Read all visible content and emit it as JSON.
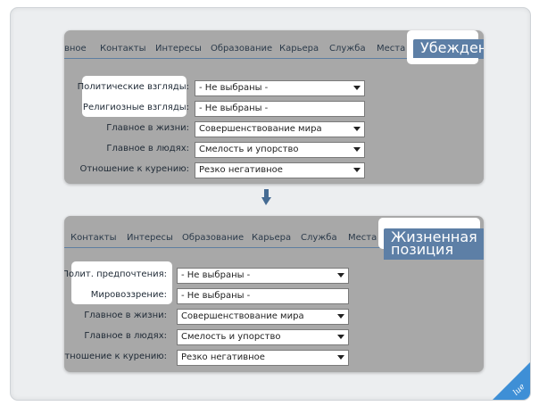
{
  "panel1": {
    "tabs": [
      "вное",
      "Контакты",
      "Интересы",
      "Образование",
      "Карьера",
      "Служба",
      "Места",
      "Убеждения"
    ],
    "active_tab": "Убеждения",
    "rows": [
      {
        "label": "Политические взгляды:",
        "value": "- Не выбраны -",
        "dropdown": true
      },
      {
        "label": "Религиозные взгляды:",
        "value": "- Не выбраны -",
        "dropdown": false
      },
      {
        "label": "Главное в жизни:",
        "value": "Совершенствование мира",
        "dropdown": true
      },
      {
        "label": "Главное в людях:",
        "value": "Смелость и упорство",
        "dropdown": true
      },
      {
        "label": "Отношение к курению:",
        "value": "Резко негативное",
        "dropdown": true
      }
    ]
  },
  "panel2": {
    "tabs": [
      "Контакты",
      "Интересы",
      "Образование",
      "Карьера",
      "Служба",
      "Места",
      "Жизненная позиция"
    ],
    "active_tab": "Жизненная позиция",
    "rows": [
      {
        "label": "Полит. предпочтения:",
        "value": "- Не выбраны -",
        "dropdown": true
      },
      {
        "label": "Мировоззрение:",
        "value": "- Не выбраны -",
        "dropdown": false
      },
      {
        "label": "Главное в жизни:",
        "value": "Совершенствование мира",
        "dropdown": true
      },
      {
        "label": "Главное в людях:",
        "value": "Смелость и упорство",
        "dropdown": true
      },
      {
        "label": "Отношение к курению:",
        "value": "Резко негативное",
        "dropdown": true
      }
    ]
  },
  "colors": {
    "panel_bg": "#a8a8a8",
    "active_tab": "#5d7fa6",
    "arrow": "#456b93",
    "corner": "#3e8fd6"
  },
  "icons": {
    "transition": "down-arrow-icon",
    "corner": "corner-badge-icon"
  },
  "corner_badge_text": "lue"
}
